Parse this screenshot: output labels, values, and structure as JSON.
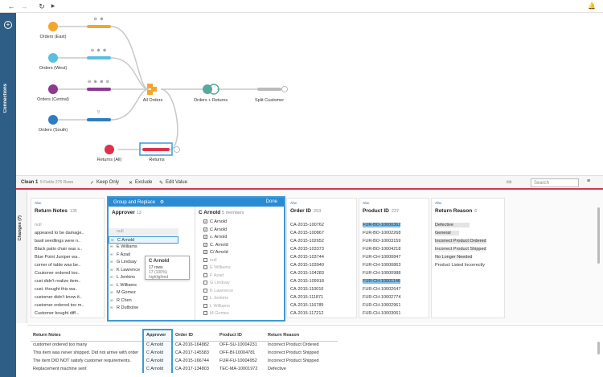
{
  "toolbar": {
    "back": "←",
    "forward": "→",
    "refresh": "↻",
    "play": "▶",
    "bell": "🔔"
  },
  "sidebar": {
    "connections_label": "Connections",
    "plus": "+"
  },
  "flow": {
    "nodes": [
      {
        "label": "Orders (East)",
        "color": "#f4a62a"
      },
      {
        "label": "Orders (West)",
        "color": "#5bc0de"
      },
      {
        "label": "Orders (Central)",
        "color": "#8b3a8f"
      },
      {
        "label": "Orders (South)",
        "color": "#2d7cc0"
      },
      {
        "label": "Returns (All)",
        "color": "#e0314b"
      }
    ],
    "union_label": "All Orders",
    "join_label": "Orders + Returns",
    "output_label": "Split Customer",
    "returns_step_label": "Returns"
  },
  "cleanbar": {
    "title": "Clean 1",
    "meta": "5 Fields  275 Rows",
    "keep_only": "Keep Only",
    "exclude": "Exclude",
    "edit_value": "Edit Value",
    "search_placeholder": "Search"
  },
  "changes_label": "Changes (7)",
  "cards": {
    "return_notes": {
      "type": "Abc",
      "title": "Return Notes",
      "count": "135",
      "values": [
        "null",
        "appeared to be damage..",
        "basil seedlings were n..",
        "Black patio chair was s..",
        "Blue Point Juniper wa..",
        "corner of table was be..",
        "Csutomer ordered too..",
        "cust didn't realize item..",
        "cust. thought this wa..",
        "customer didn't know it..",
        "customer ordered too m..",
        "Customer bought diff..."
      ]
    },
    "order_id": {
      "type": "Abc",
      "title": "Order ID",
      "count": "253",
      "values": [
        "CA-2015-100762",
        "CA-2015-100867",
        "CA-2015-102652",
        "CA-2015-103373",
        "CA-2015-103744",
        "CA-2015-103940",
        "CA-2015-104283",
        "CA-2015-109918",
        "CA-2015-110016",
        "CA-2015-111871",
        "CA-2015-116785",
        "CA-2015-117212"
      ]
    },
    "product_id": {
      "type": "Abc",
      "title": "Product ID",
      "count": "237",
      "values": [
        "FUR-BO-10000362",
        "FUR-BO-10002268",
        "FUR-BO-10003159",
        "FUR-BO-10004218",
        "FUR-CH-10000847",
        "FUR-CH-10000863",
        "FUR-CH-10000988",
        "FUR-CH-10001146",
        "FUR-CH-10002647",
        "FUR-CH-10002774",
        "FUR-CH-10002961",
        "FUR-CH-10003061"
      ]
    },
    "return_reason": {
      "type": "Abc",
      "title": "Return Reason",
      "count": "6",
      "values": [
        "Defective",
        "General",
        "Incorrect Product Ordered",
        "Incorrect Product Shipped",
        "No Longer Needed",
        "Product Listed Incorrectly"
      ]
    }
  },
  "group_replace": {
    "title": "Group and Replace",
    "done": "Done",
    "approver_title": "Approver",
    "approver_count": "13",
    "approver_values": [
      "null",
      "C Arnold",
      "E Williams",
      "F Azad",
      "G Lindsay",
      "K Lawrence",
      "L Jenkins",
      "L Williams",
      "M Gomez",
      "R Chen",
      "R Dutboise"
    ],
    "group_title": "C Arnold",
    "group_count": "5 members",
    "members": [
      "C Arnold",
      "C Arnold",
      "c. Arnold",
      "C. Arnold",
      "C/ Arnold"
    ],
    "others": [
      "null",
      "E Williams",
      "F Azad",
      "G Lindsay",
      "K Lawrence",
      "L Jenkins",
      "L Williams",
      "M Gomez",
      "R Chen",
      "R Dutboise"
    ],
    "tooltip_name": "C Arnold",
    "tooltip_rows": "17 rows",
    "tooltip_pct": "17 (100%) highlighted"
  },
  "grid": {
    "headers": [
      "Return Notes",
      "Approver",
      "Order ID",
      "Product ID",
      "Return Reason"
    ],
    "rows": [
      [
        "customer ordered too many",
        "C Arnold",
        "CA-2016-164882",
        "OFF-SU-10004231",
        "Incorrect Product Ordered"
      ],
      [
        "This item was never shipped. Did not arrive with order",
        "C Arnold",
        "CA-2017-145583",
        "OFF-BI-10004781",
        "Incorrect Product Shipped"
      ],
      [
        "The item DID NOT satisfy customer requirements.",
        "C Arnold",
        "CA-2015-166744",
        "FUR-FU-10004952",
        "Incorrect Product Shipped"
      ],
      [
        "Replacement machine sent",
        "C Arnold",
        "CA-2017-134803",
        "TEC-MA-10001972",
        "Defective"
      ]
    ]
  }
}
